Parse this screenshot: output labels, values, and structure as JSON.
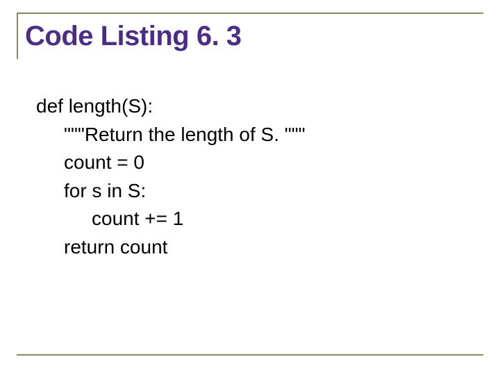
{
  "title": "Code Listing 6. 3",
  "code": {
    "line1": "def length(S):",
    "line2": "\"\"\"Return the length of S. \"\"\"",
    "line3": "count = 0",
    "line4": "for s in S:",
    "line5": "count += 1",
    "line6": "return count"
  }
}
